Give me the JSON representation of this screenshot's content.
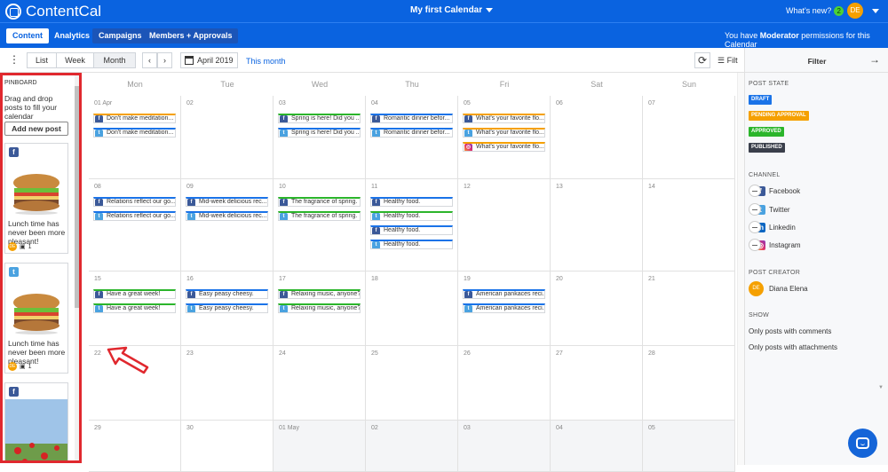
{
  "app": {
    "name": "ContentCal",
    "calendar_title": "My first Calendar",
    "whats_new": "What's new?",
    "whats_new_count": "2",
    "user_initials": "DE"
  },
  "nav": {
    "tabs": [
      "Content",
      "Analytics",
      "Campaigns",
      "Members + Approvals"
    ],
    "permission_prefix": "You have ",
    "permission_role": "Moderator",
    "permission_suffix": " permissions for this Calendar"
  },
  "toolbar": {
    "views": [
      "List",
      "Week",
      "Month"
    ],
    "active_view": "Month",
    "date": "April 2019",
    "this_month": "This month",
    "filter": "Filt"
  },
  "pinboard": {
    "header": "PINBOARD",
    "hint": "Drag and drop posts to fill your calendar",
    "add_button": "Add new post",
    "cards": [
      {
        "network": "facebook",
        "text": "Lunch time has never been more pleasant!",
        "author": "DE",
        "count": "1"
      },
      {
        "network": "twitter",
        "text": "Lunch time has never been more pleasant!",
        "author": "DE",
        "count": "1"
      },
      {
        "network": "facebook",
        "text": "",
        "author": "",
        "count": ""
      }
    ]
  },
  "calendar": {
    "days": [
      "Mon",
      "Tue",
      "Wed",
      "Thu",
      "Fri",
      "Sat",
      "Sun"
    ],
    "weeks": [
      [
        {
          "num": "01 Apr",
          "posts": [
            {
              "net": "facebook",
              "state": "pending",
              "text": "Don't make meditation..."
            },
            {
              "net": "twitter",
              "state": "published",
              "text": "Don't make meditation..."
            }
          ]
        },
        {
          "num": "02",
          "posts": []
        },
        {
          "num": "03",
          "posts": [
            {
              "net": "facebook",
              "state": "approved",
              "text": "Spring is here! Did you ..."
            },
            {
              "net": "twitter",
              "state": "published",
              "text": "Spring is here! Did you ..."
            }
          ]
        },
        {
          "num": "04",
          "posts": [
            {
              "net": "facebook",
              "state": "published",
              "text": "Romantic dinner befor..."
            },
            {
              "net": "twitter",
              "state": "published",
              "text": "Romantic dinner befor..."
            }
          ]
        },
        {
          "num": "05",
          "posts": [
            {
              "net": "facebook",
              "state": "pending",
              "text": "What's your favorite flo..."
            },
            {
              "net": "twitter",
              "state": "pending",
              "text": "What's your favorite flo..."
            },
            {
              "net": "instagram",
              "state": "pending",
              "text": "What's your favorite flo..."
            }
          ]
        },
        {
          "num": "06",
          "posts": []
        },
        {
          "num": "07",
          "posts": []
        }
      ],
      [
        {
          "num": "08",
          "posts": [
            {
              "net": "facebook",
              "state": "published",
              "text": "Relations reflect our go..."
            },
            {
              "net": "twitter",
              "state": "published",
              "text": "Relations reflect our go..."
            }
          ]
        },
        {
          "num": "09",
          "posts": [
            {
              "net": "facebook",
              "state": "published",
              "text": "Mid-week delicious rec..."
            },
            {
              "net": "twitter",
              "state": "published",
              "text": "Mid-week delicious rec..."
            }
          ]
        },
        {
          "num": "10",
          "posts": [
            {
              "net": "facebook",
              "state": "approved",
              "text": "The fragrance of spring."
            },
            {
              "net": "twitter",
              "state": "approved",
              "text": "The fragrance of spring."
            }
          ]
        },
        {
          "num": "11",
          "posts": [
            {
              "net": "facebook",
              "state": "published",
              "text": "Healthy food."
            },
            {
              "net": "twitter",
              "state": "approved",
              "text": "Healthy food."
            },
            {
              "net": "facebook",
              "state": "published",
              "text": "Healthy food."
            },
            {
              "net": "twitter",
              "state": "published",
              "text": "Healthy food."
            }
          ]
        },
        {
          "num": "12",
          "posts": []
        },
        {
          "num": "13",
          "posts": []
        },
        {
          "num": "14",
          "posts": []
        }
      ],
      [
        {
          "num": "15",
          "posts": [
            {
              "net": "facebook",
              "state": "approved",
              "text": "Have a great week!"
            },
            {
              "net": "twitter",
              "state": "approved",
              "text": "Have a great week!"
            }
          ]
        },
        {
          "num": "16",
          "posts": [
            {
              "net": "facebook",
              "state": "published",
              "text": "Easy peasy cheesy."
            },
            {
              "net": "twitter",
              "state": "published",
              "text": "Easy peasy cheesy."
            }
          ]
        },
        {
          "num": "17",
          "posts": [
            {
              "net": "facebook",
              "state": "approved",
              "text": "Relaxing music, anyone?"
            },
            {
              "net": "twitter",
              "state": "approved",
              "text": "Relaxing music, anyone?"
            }
          ]
        },
        {
          "num": "18",
          "posts": []
        },
        {
          "num": "19",
          "posts": [
            {
              "net": "facebook",
              "state": "published",
              "text": "American pankaces reci..."
            },
            {
              "net": "twitter",
              "state": "published",
              "text": "American pankaces reci..."
            }
          ]
        },
        {
          "num": "20",
          "posts": []
        },
        {
          "num": "21",
          "posts": []
        }
      ],
      [
        {
          "num": "22",
          "posts": []
        },
        {
          "num": "23",
          "posts": []
        },
        {
          "num": "24",
          "posts": []
        },
        {
          "num": "25",
          "posts": []
        },
        {
          "num": "26",
          "posts": []
        },
        {
          "num": "27",
          "posts": []
        },
        {
          "num": "28",
          "posts": []
        }
      ],
      [
        {
          "num": "29",
          "posts": []
        },
        {
          "num": "30",
          "posts": []
        },
        {
          "num": "01 May",
          "posts": []
        },
        {
          "num": "02",
          "posts": []
        },
        {
          "num": "03",
          "posts": []
        },
        {
          "num": "04",
          "posts": []
        },
        {
          "num": "05",
          "posts": []
        }
      ]
    ]
  },
  "filter": {
    "title": "Filter",
    "post_state_label": "POST STATE",
    "states": [
      {
        "label": "DRAFT",
        "color": "#1a73e8"
      },
      {
        "label": "PENDING APPROVAL",
        "color": "#f5a000"
      },
      {
        "label": "APPROVED",
        "color": "#2bb52b"
      },
      {
        "label": "PUBLISHED",
        "color": "#3a3f4b"
      }
    ],
    "channel_label": "CHANNEL",
    "channels": [
      {
        "label": "Facebook",
        "icon": "facebook-icon"
      },
      {
        "label": "Twitter",
        "icon": "twitter-icon"
      },
      {
        "label": "Linkedin",
        "icon": "linkedin-icon"
      },
      {
        "label": "Instagram",
        "icon": "instagram-icon"
      }
    ],
    "creator_label": "POST CREATOR",
    "creator_name": "Diana Elena",
    "creator_initials": "DE",
    "show_label": "SHOW",
    "show_options": [
      "Only posts with comments",
      "Only posts with attachments"
    ]
  },
  "colors": {
    "brand": "#0a63e0",
    "highlight": "#e0282e",
    "published": "#1a73e8",
    "approved": "#2bb52b",
    "pending": "#f5a000"
  }
}
